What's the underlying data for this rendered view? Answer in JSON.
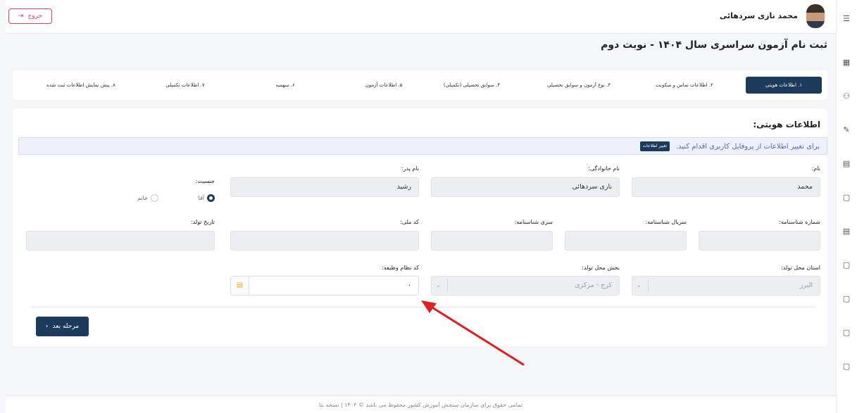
{
  "user": {
    "name": "محمد نازی سردهائی",
    "logout_label": "خروج"
  },
  "page": {
    "title": "ثبت نام آزمون سراسری سال ۱۴۰۴ - نوبت دوم"
  },
  "steps": [
    {
      "label": "۱. اطلاعات هویتی",
      "active": true
    },
    {
      "label": "۲. اطلاعات تماس و سکونت"
    },
    {
      "label": "۳. نوع آزمون و سوابق تحصیلی"
    },
    {
      "label": "۴. سوابق تحصیلی (تکمیلی)"
    },
    {
      "label": "۵. اطلاعات آزمون"
    },
    {
      "label": "۶. سهمیه"
    },
    {
      "label": "۷. اطلاعات تکمیلی"
    },
    {
      "label": "۸. پیش نمایش اطلاعات ثبت شده"
    }
  ],
  "section": {
    "title": "اطلاعات هویتی:",
    "info_text": "برای تغییر اطلاعات از پروفایل کاربری اقدام کنید.",
    "info_button": "تغییر اطلاعات"
  },
  "fields": {
    "first_name": {
      "label": "نام:",
      "value": "محمد"
    },
    "last_name": {
      "label": "نام خانوادگی:",
      "value": "نازی سردهائی"
    },
    "father_name": {
      "label": "نام پدر:",
      "value": "رشید"
    },
    "gender": {
      "label": "جنسیت:",
      "options": [
        "آقا",
        "خانم"
      ],
      "selected": "آقا"
    },
    "id_number": {
      "label": "شماره شناسنامه:",
      "value": ""
    },
    "id_serial": {
      "label": "سریال شناسنامه:",
      "value": ""
    },
    "id_series": {
      "label": "سری شناسنامه:",
      "value": ""
    },
    "national_code": {
      "label": "کد ملی:",
      "value": ""
    },
    "birth_date": {
      "label": "تاریخ تولد:",
      "value": ""
    },
    "birth_province": {
      "label": "استان محل تولد:",
      "value": "البرز"
    },
    "birth_district": {
      "label": "بخش محل تولد:",
      "value": "کرج - مرکزی"
    },
    "military_code": {
      "label": "کد نظام وظیفه:",
      "value": "۰"
    }
  },
  "next_button": "مرحله بعد",
  "footer": "تمامی حقوق برای سازمان سنجش آموزش کشور محفوظ می باشد © ۱۴۰۳ | نسخه بتا",
  "colors": {
    "primary": "#1b3a5c",
    "danger": "#e0405a",
    "info_bg": "#eef0fb",
    "annotation": "#e02020"
  }
}
